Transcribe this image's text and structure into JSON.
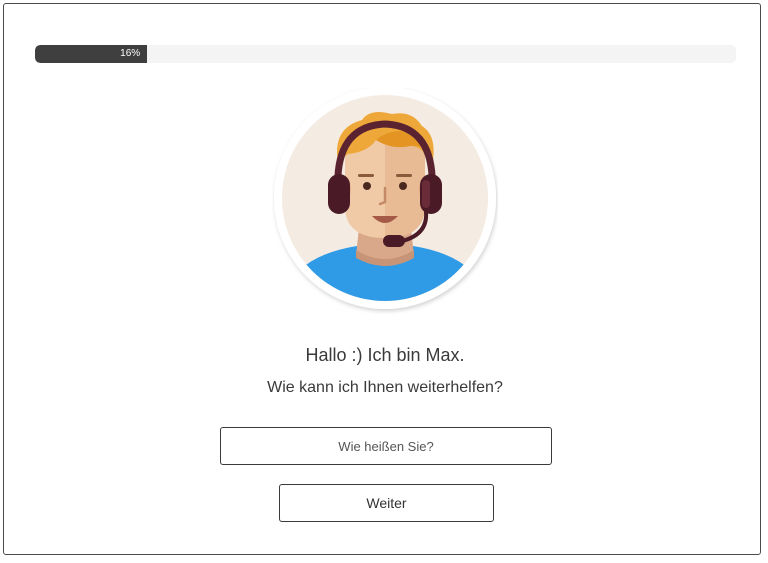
{
  "progress": {
    "label": "16%",
    "fraction": 0.16,
    "fill_color": "#3f3f3f",
    "track_color": "#f4f4f4"
  },
  "avatar": {
    "icon": "support-agent-avatar-icon"
  },
  "chat": {
    "greeting": "Hallo :) Ich bin Max.",
    "question": "Wie kann ich Ihnen weiterhelfen?"
  },
  "form": {
    "name_placeholder": "Wie heißen Sie?",
    "name_value": "",
    "next_label": "Weiter"
  }
}
